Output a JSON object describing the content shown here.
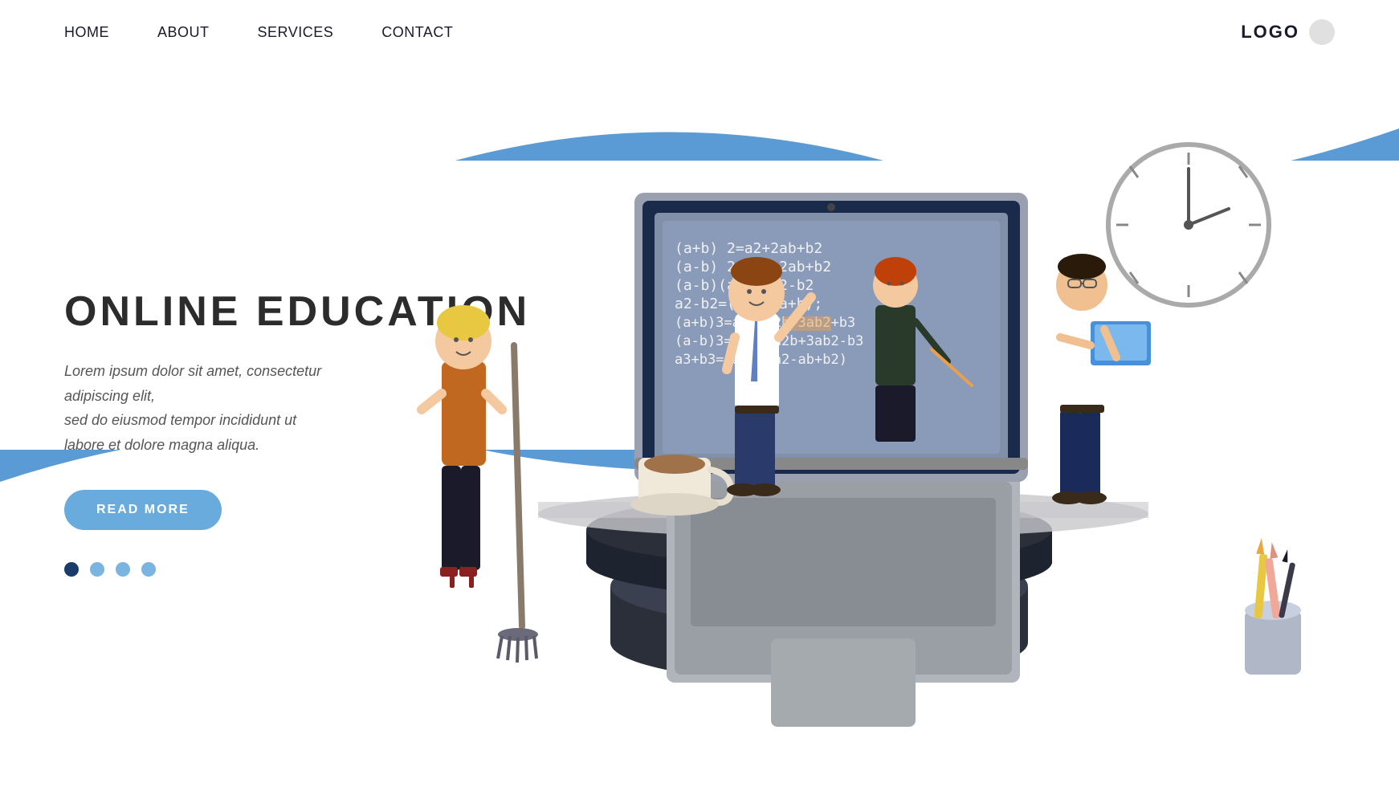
{
  "nav": {
    "links": [
      {
        "label": "HOME",
        "id": "home"
      },
      {
        "label": "ABOUT",
        "id": "about"
      },
      {
        "label": "SERVICES",
        "id": "services"
      },
      {
        "label": "CONTACT",
        "id": "contact"
      }
    ],
    "logo_text": "LOGO",
    "logo_icon": "circle"
  },
  "hero": {
    "headline": "ONLINE  EDUCATION",
    "description": "Lorem ipsum dolor sit amet, consectetur adipiscing elit,\nsed do eiusmod tempor incididunt ut\nlabore et dolore magna aliqua.",
    "cta_label": "READ MORE",
    "dots": [
      {
        "active": true
      },
      {
        "active": false
      },
      {
        "active": false
      },
      {
        "active": false
      }
    ]
  },
  "illustration": {
    "math_content": "(a+b) 2=a2+2ab+b2\n(a-b) 2=a 2-2ab+b2\n(a-b)(a+b)=a2-b2\na2-b2=(a-b)(a+b);\n(a+b)3=a3+3a2b+3ab2+b3\n(a-b)3= a3-3a2b+3ab2-b3\na3+b3=(a+b)(a2-ab+b2)",
    "coffee_cup": "☕",
    "pencils": "✏️"
  },
  "colors": {
    "blue_bg": "#5b9bd5",
    "nav_link": "#1a1a2e",
    "headline": "#2c2c2c",
    "description": "#555555",
    "button_bg": "#6aabde",
    "dot_active": "#1a3c6b",
    "dot_inactive": "#7ab4e0"
  }
}
